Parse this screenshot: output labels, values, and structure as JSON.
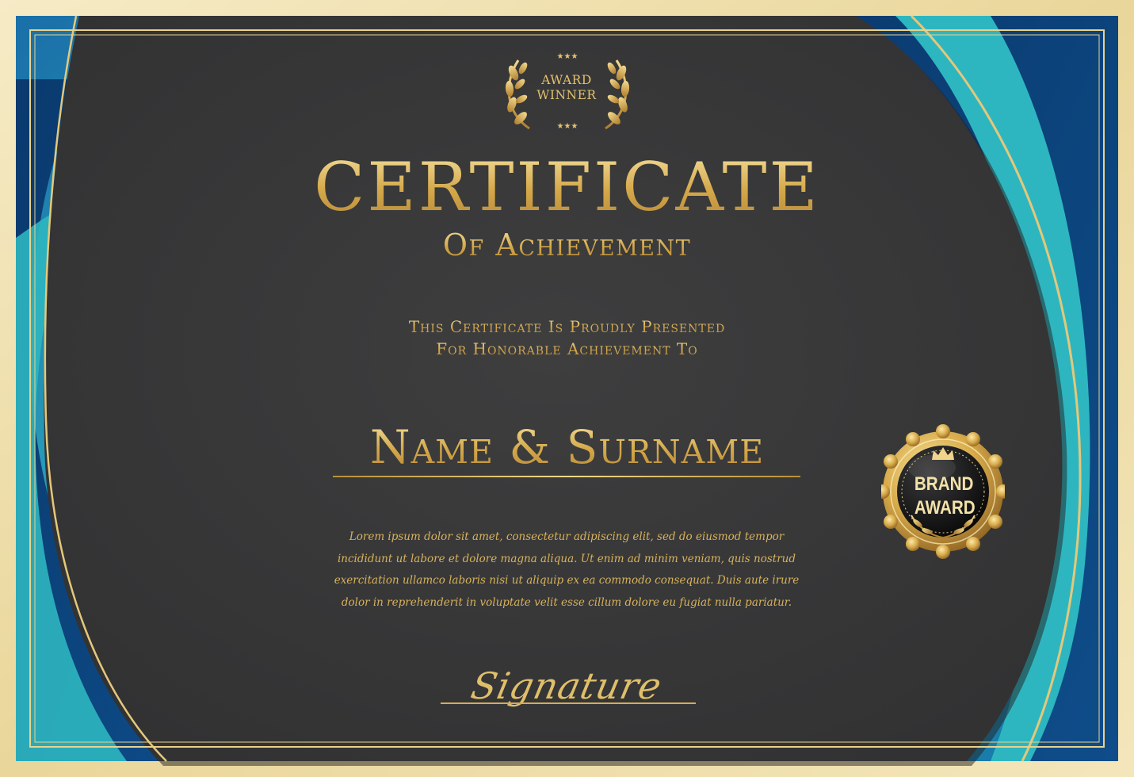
{
  "badge": {
    "line1": "AWARD",
    "line2": "WINNER",
    "stars_icon": "three-stars"
  },
  "title": {
    "main": "CERTIFICATE",
    "sub": "Of Achievement"
  },
  "presented": {
    "line1": "This Certificate Is Proudly Presented",
    "line2": "For Honorable Achievement To"
  },
  "recipient": {
    "name": "Name & Surname"
  },
  "body_text": "Lorem ipsum dolor sit amet, consectetur adipiscing elit, sed do eiusmod tempor incididunt ut labore et dolore magna aliqua. Ut enim ad minim veniam, quis nostrud exercitation ullamco laboris nisi ut aliquip ex ea commodo consequat. Duis aute irure dolor in reprehenderit in voluptate velit esse cillum dolore eu fugiat nulla pariatur.",
  "signature": {
    "label": "Signature"
  },
  "seal": {
    "line1": "BRAND",
    "line2": "AWARD",
    "icon": "crown-icon"
  },
  "colors": {
    "gold": "#d4a748",
    "gold_light": "#f6e3a1",
    "dark_panel": "#383839",
    "teal": "#2fb3bf",
    "navy": "#0c3f76",
    "cream_border": "#f3e8c0"
  }
}
